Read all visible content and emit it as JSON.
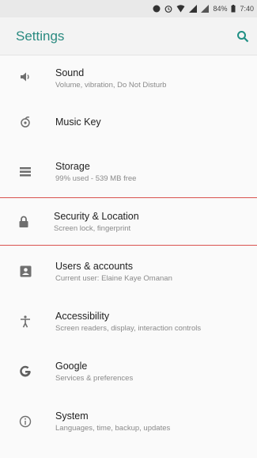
{
  "status_bar": {
    "battery": "84%",
    "time": "7:40"
  },
  "toolbar": {
    "title": "Settings"
  },
  "items": [
    {
      "icon": "volume-icon",
      "label": "Sound",
      "subtitle": "Volume, vibration, Do Not Disturb"
    },
    {
      "icon": "music-key-icon",
      "label": "Music Key",
      "subtitle": ""
    },
    {
      "icon": "storage-icon",
      "label": "Storage",
      "subtitle": "99% used - 539 MB free"
    },
    {
      "icon": "lock-icon",
      "label": "Security & Location",
      "subtitle": "Screen lock, fingerprint"
    },
    {
      "icon": "person-card-icon",
      "label": "Users & accounts",
      "subtitle": "Current user: Elaine Kaye Omanan"
    },
    {
      "icon": "accessibility-icon",
      "label": "Accessibility",
      "subtitle": "Screen readers, display, interaction controls"
    },
    {
      "icon": "google-icon",
      "label": "Google",
      "subtitle": "Services & preferences"
    },
    {
      "icon": "info-icon",
      "label": "System",
      "subtitle": "Languages, time, backup, updates"
    }
  ],
  "colors": {
    "accent": "#2a8a80",
    "highlight_border": "#d9534f"
  }
}
